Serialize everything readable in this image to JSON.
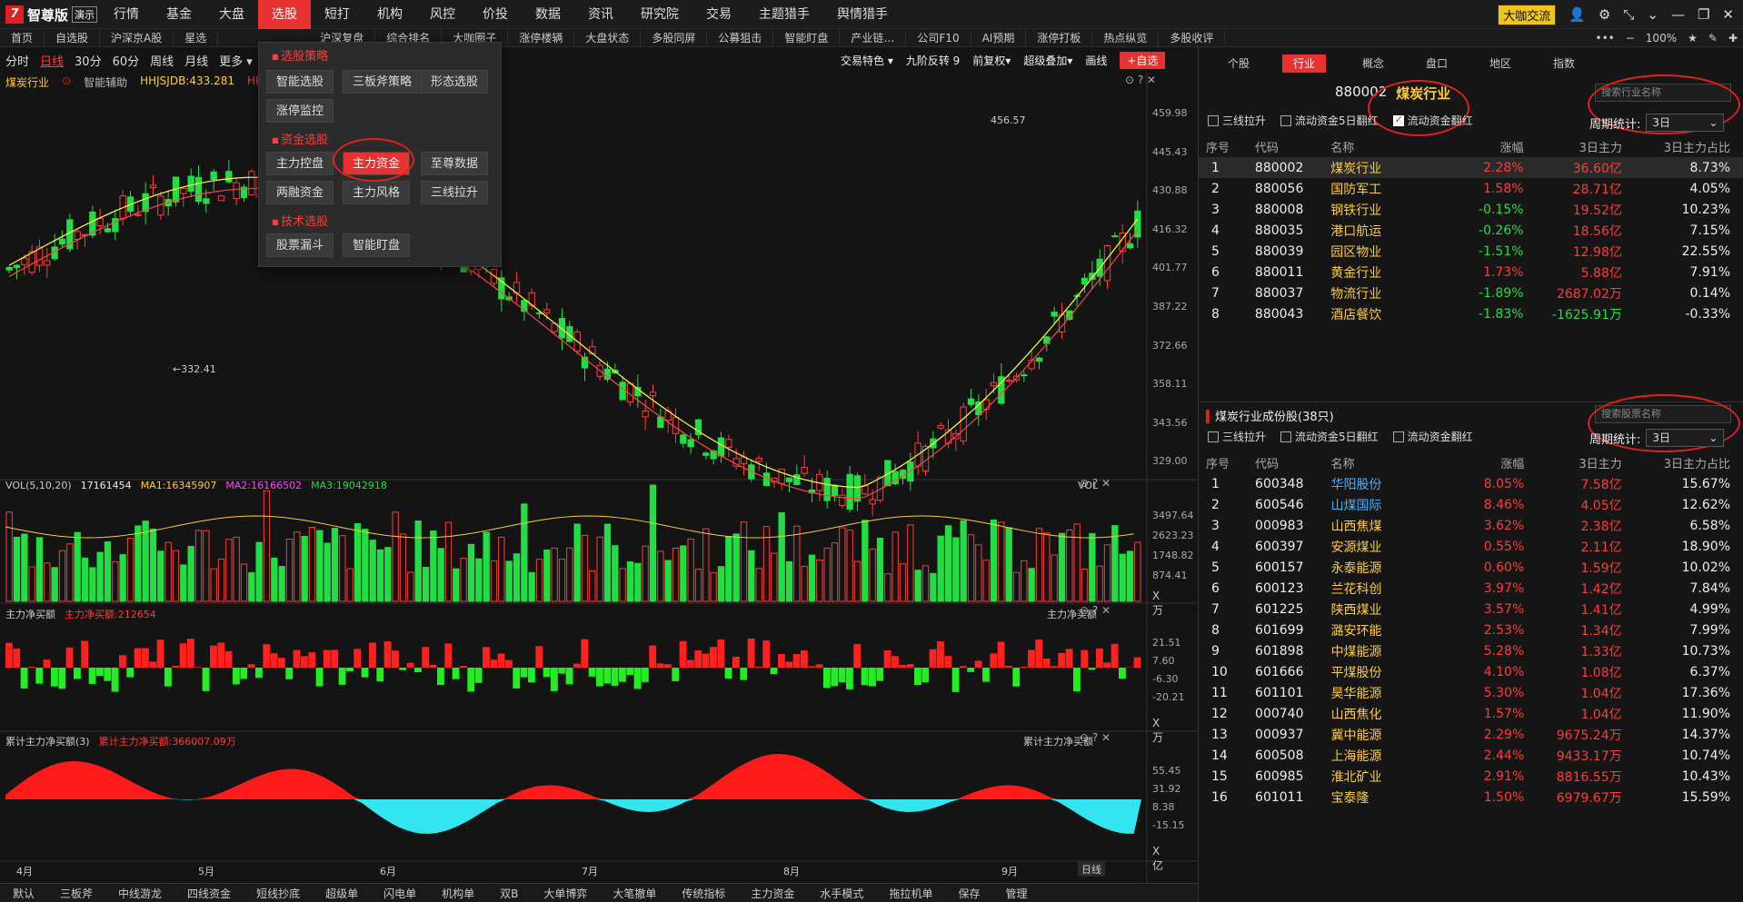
{
  "app": {
    "name": "智尊版",
    "badge": "演示"
  },
  "menu": [
    {
      "label": "行情",
      "dot": true
    },
    {
      "label": "基金",
      "dot": true
    },
    {
      "label": "大盘",
      "dot": false
    },
    {
      "label": "选股",
      "dot": false,
      "active": true
    },
    {
      "label": "短打",
      "dot": false
    },
    {
      "label": "机构",
      "dot": true
    },
    {
      "label": "风控",
      "dot": false
    },
    {
      "label": "价投",
      "dot": false
    },
    {
      "label": "数据",
      "dot": false
    },
    {
      "label": "资讯",
      "dot": false
    },
    {
      "label": "研究院",
      "dot": false
    },
    {
      "label": "交易",
      "dot": false
    },
    {
      "label": "主题猎手",
      "dot": false
    },
    {
      "label": "舆情猎手",
      "dot": false
    }
  ],
  "top_right": {
    "daka": "大咖交流"
  },
  "bar2": [
    "首页",
    "自选股",
    "沪深京A股",
    "星选",
    "",
    "",
    "",
    "",
    "沪深复盘",
    "综合排名",
    "大咖圈子",
    "涨停楼辆",
    "大盘状态",
    "多股同屏",
    "公募狙击",
    "智能盯盘",
    "产业链…",
    "公司F10",
    "AI预期",
    "涨停打板",
    "热点纵览",
    "多股收评"
  ],
  "bar2_right": {
    "more": "•••",
    "zoom": "100%"
  },
  "periods": [
    "分时",
    "日线",
    "30分",
    "60分",
    "周线",
    "月线",
    "更多 ▾"
  ],
  "chart_toolbar": [
    "交易特色 ▾",
    "九阶反转 9",
    "前复权▾",
    "超级叠加▾",
    "画线"
  ],
  "add_fav": "+自选",
  "chart_info": {
    "name": "煤炭行业",
    "assist": "智能辅助",
    "indicator": "HHJSJDB:433.281",
    "indicator2": "HH"
  },
  "y_axis_main": [
    "459.98",
    "445.43",
    "430.88",
    "416.32",
    "401.77",
    "387.22",
    "372.66",
    "358.11",
    "343.56",
    "329.00"
  ],
  "annotations": {
    "high": "456.57",
    "low": "332.41"
  },
  "vol": {
    "title": "VOL(5,10,20)",
    "value": "17161454",
    "ma1": "MA1:16345907",
    "ma2": "MA2:16166502",
    "ma3": "MA3:19042918",
    "right": "VOL",
    "axis": [
      "3497.64",
      "2623.23",
      "1748.82",
      "874.41"
    ],
    "unit": "X万"
  },
  "net": {
    "title": "主力净买额",
    "value": "主力净买额:212654",
    "right": "主力净买额",
    "axis": [
      "21.51",
      "7.60",
      "-6.30",
      "-20.21"
    ],
    "unit": "X万"
  },
  "cum": {
    "title": "累计主力净买额(3)",
    "value": "累计主力净买额:366007.09万",
    "right": "累计主力净买额",
    "axis": [
      "55.45",
      "31.92",
      "8.38",
      "-15.15"
    ],
    "unit": "X亿"
  },
  "months": [
    "4月",
    "5月",
    "6月",
    "7月",
    "8月",
    "9月"
  ],
  "bottom_tabs": [
    "默认",
    "三板斧",
    "中线游龙",
    "四线资金",
    "短线抄底",
    "超级单",
    "闪电单",
    "机构单",
    "双B",
    "大单博弈",
    "大笔撤单",
    "传统指标",
    "主力资金",
    "水手模式",
    "拖拉机单",
    "保存",
    "管理"
  ],
  "right_corner": "日线",
  "popup": {
    "s1": "选股策略",
    "b1": [
      "智能选股",
      "三板斧策略",
      "形态选股",
      "涨停监控"
    ],
    "s2": "资金选股",
    "b2": [
      "主力控盘",
      "主力资金",
      "至尊数据",
      "两融资金",
      "主力风格",
      "三线拉升"
    ],
    "s3": "技术选股",
    "b3": [
      "股票漏斗",
      "智能盯盘"
    ]
  },
  "right_tabs": [
    "个股",
    "行业",
    "概念",
    "盘口",
    "地区",
    "指数"
  ],
  "sector": {
    "code": "880002",
    "name": "煤炭行业"
  },
  "filters1": [
    {
      "label": "三线拉升",
      "checked": false
    },
    {
      "label": "流动资金5日翻红",
      "checked": false
    },
    {
      "label": "流动资金翻红",
      "checked": true
    }
  ],
  "search1": "搜索行业名称",
  "period_label": "周期统计:",
  "period_value": "3日",
  "headers": [
    "序号",
    "代码",
    "名称",
    "涨幅",
    "3日主力",
    "3日主力占比"
  ],
  "industries": [
    [
      "1",
      "880002",
      "煤炭行业",
      "2.28%",
      "36.60亿",
      "8.73%"
    ],
    [
      "2",
      "880056",
      "国防军工",
      "1.58%",
      "28.71亿",
      "4.05%"
    ],
    [
      "3",
      "880008",
      "钢铁行业",
      "-0.15%",
      "19.52亿",
      "10.23%"
    ],
    [
      "4",
      "880035",
      "港口航运",
      "-0.26%",
      "18.56亿",
      "7.15%"
    ],
    [
      "5",
      "880039",
      "园区物业",
      "-1.51%",
      "12.98亿",
      "22.55%"
    ],
    [
      "6",
      "880011",
      "黄金行业",
      "1.73%",
      "5.88亿",
      "7.91%"
    ],
    [
      "7",
      "880037",
      "物流行业",
      "-1.89%",
      "2687.02万",
      "0.14%"
    ],
    [
      "8",
      "880043",
      "酒店餐饮",
      "-1.83%",
      "-1625.91万",
      "-0.33%"
    ]
  ],
  "stocks_title": "煤炭行业成份股(38只)",
  "filters2": [
    {
      "label": "三线拉升",
      "checked": false
    },
    {
      "label": "流动资金5日翻红",
      "checked": false
    },
    {
      "label": "流动资金翻红",
      "checked": false
    }
  ],
  "search2": "搜索股票名称",
  "stocks": [
    [
      "1",
      "600348",
      "华阳股份",
      "8.05%",
      "7.58亿",
      "15.67%"
    ],
    [
      "2",
      "600546",
      "山煤国际",
      "8.46%",
      "4.05亿",
      "12.62%"
    ],
    [
      "3",
      "000983",
      "山西焦煤",
      "3.62%",
      "2.38亿",
      "6.58%"
    ],
    [
      "4",
      "600397",
      "安源煤业",
      "0.55%",
      "2.11亿",
      "18.90%"
    ],
    [
      "5",
      "600157",
      "永泰能源",
      "0.60%",
      "1.59亿",
      "10.02%"
    ],
    [
      "6",
      "600123",
      "兰花科创",
      "3.97%",
      "1.42亿",
      "7.84%"
    ],
    [
      "7",
      "601225",
      "陕西煤业",
      "3.57%",
      "1.41亿",
      "4.99%"
    ],
    [
      "8",
      "601699",
      "潞安环能",
      "2.53%",
      "1.34亿",
      "7.99%"
    ],
    [
      "9",
      "601898",
      "中煤能源",
      "5.28%",
      "1.33亿",
      "10.73%"
    ],
    [
      "10",
      "601666",
      "平煤股份",
      "4.10%",
      "1.08亿",
      "6.37%"
    ],
    [
      "11",
      "601101",
      "昊华能源",
      "5.30%",
      "1.04亿",
      "17.36%"
    ],
    [
      "12",
      "000740",
      "山西焦化",
      "1.57%",
      "1.04亿",
      "11.90%"
    ],
    [
      "13",
      "000937",
      "冀中能源",
      "2.29%",
      "9675.24万",
      "14.37%"
    ],
    [
      "14",
      "600508",
      "上海能源",
      "2.44%",
      "9433.17万",
      "10.74%"
    ],
    [
      "15",
      "600985",
      "淮北矿业",
      "2.91%",
      "8816.55万",
      "10.43%"
    ],
    [
      "16",
      "601011",
      "宝泰隆",
      "1.50%",
      "6979.67万",
      "15.59%"
    ]
  ],
  "colors": {
    "accent": "#e83232",
    "up": "#ff3b3b",
    "down": "#22dd44",
    "ma5": "#ffff33",
    "ma10": "#ff4444"
  }
}
